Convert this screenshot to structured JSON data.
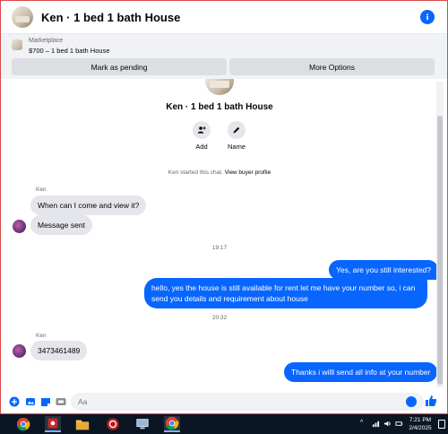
{
  "header": {
    "title": "Ken · 1 bed 1 bath House",
    "info_icon": "info-icon"
  },
  "marketplace": {
    "label": "Marketplace",
    "listing": "$700 – 1 bed 1 bath House",
    "mark_pending": "Mark as pending",
    "more_options": "More Options"
  },
  "chat_intro": {
    "title": "Ken · 1 bed 1 bath House",
    "actions": [
      {
        "label": "Add",
        "icon": "add-person-icon"
      },
      {
        "label": "Name",
        "icon": "pencil-icon"
      }
    ],
    "started_text": "Ken started this chat.",
    "view_profile": "View buyer profile"
  },
  "messages": {
    "sender1": "Ken",
    "m1": "When can I come and view it?",
    "m2": "Message sent",
    "time1": "19:17",
    "m3": "Yes, are you still interested?",
    "m4": "hello, yes the house is still available for rent  let me have your number so, i can send you details and requirement about house",
    "time2": "20:32",
    "sender2": "Ken",
    "m5": "3473461489",
    "m6": "Thanks i willl send all info at your number"
  },
  "composer": {
    "placeholder": "Aa"
  },
  "taskbar": {
    "time": "7:21 PM",
    "date": "2/4/2025"
  },
  "colors": {
    "accent": "#0866ff",
    "incoming_bubble": "#e4e6eb",
    "frame_border": "#d84a4a",
    "taskbar": "#0b1624"
  }
}
